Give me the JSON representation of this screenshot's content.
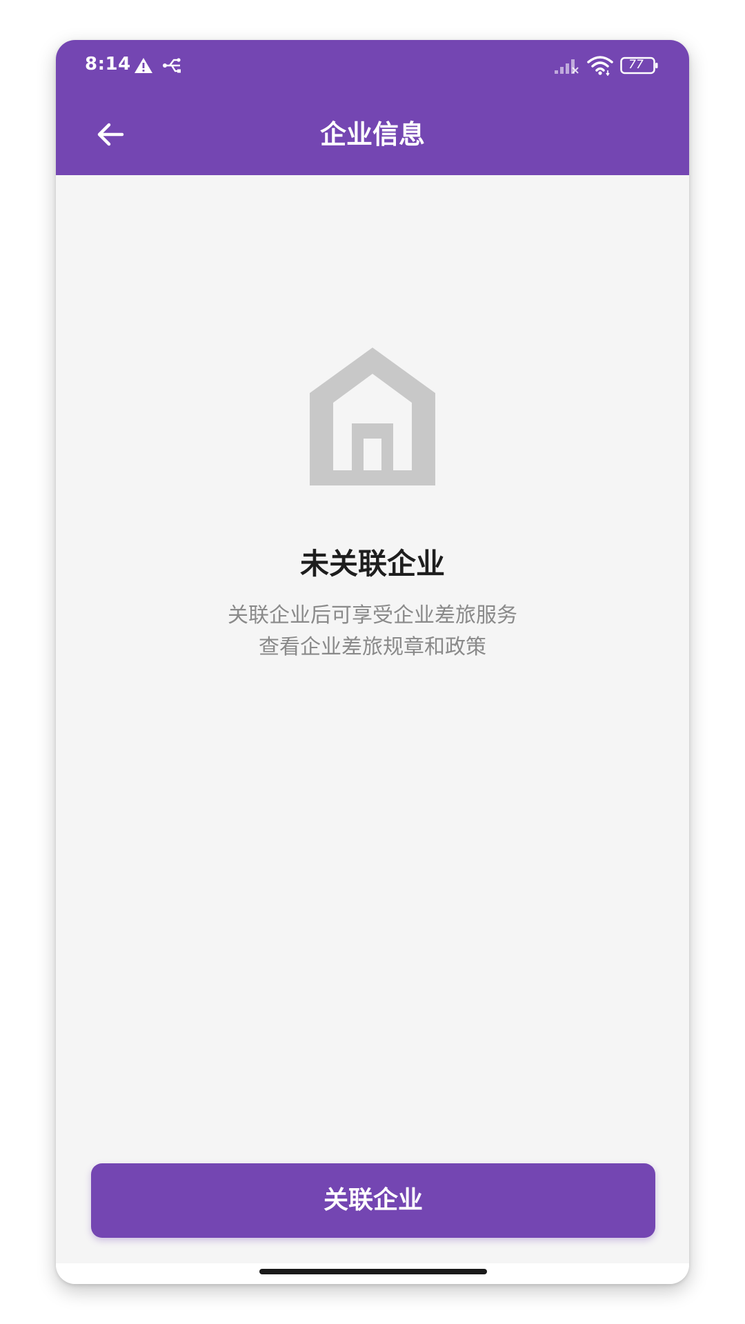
{
  "status_bar": {
    "time": "8:14",
    "battery": "77",
    "icons": [
      "warning-icon",
      "usb-icon",
      "signal-icon",
      "wifi-icon",
      "battery-icon"
    ]
  },
  "app_bar": {
    "title": "企业信息",
    "back_icon": "arrow-left-icon"
  },
  "empty_state": {
    "icon": "house-icon",
    "title": "未关联企业",
    "desc_line1": "关联企业后可享受企业差旅服务",
    "desc_line2": "查看企业差旅规章和政策"
  },
  "actions": {
    "link_company_label": "关联企业"
  },
  "colors": {
    "primary": "#7446b2",
    "background": "#f5f5f5",
    "icon_gray": "#c8c8c8",
    "title_text": "#1e1e1e",
    "desc_text": "#8a8a8a"
  }
}
